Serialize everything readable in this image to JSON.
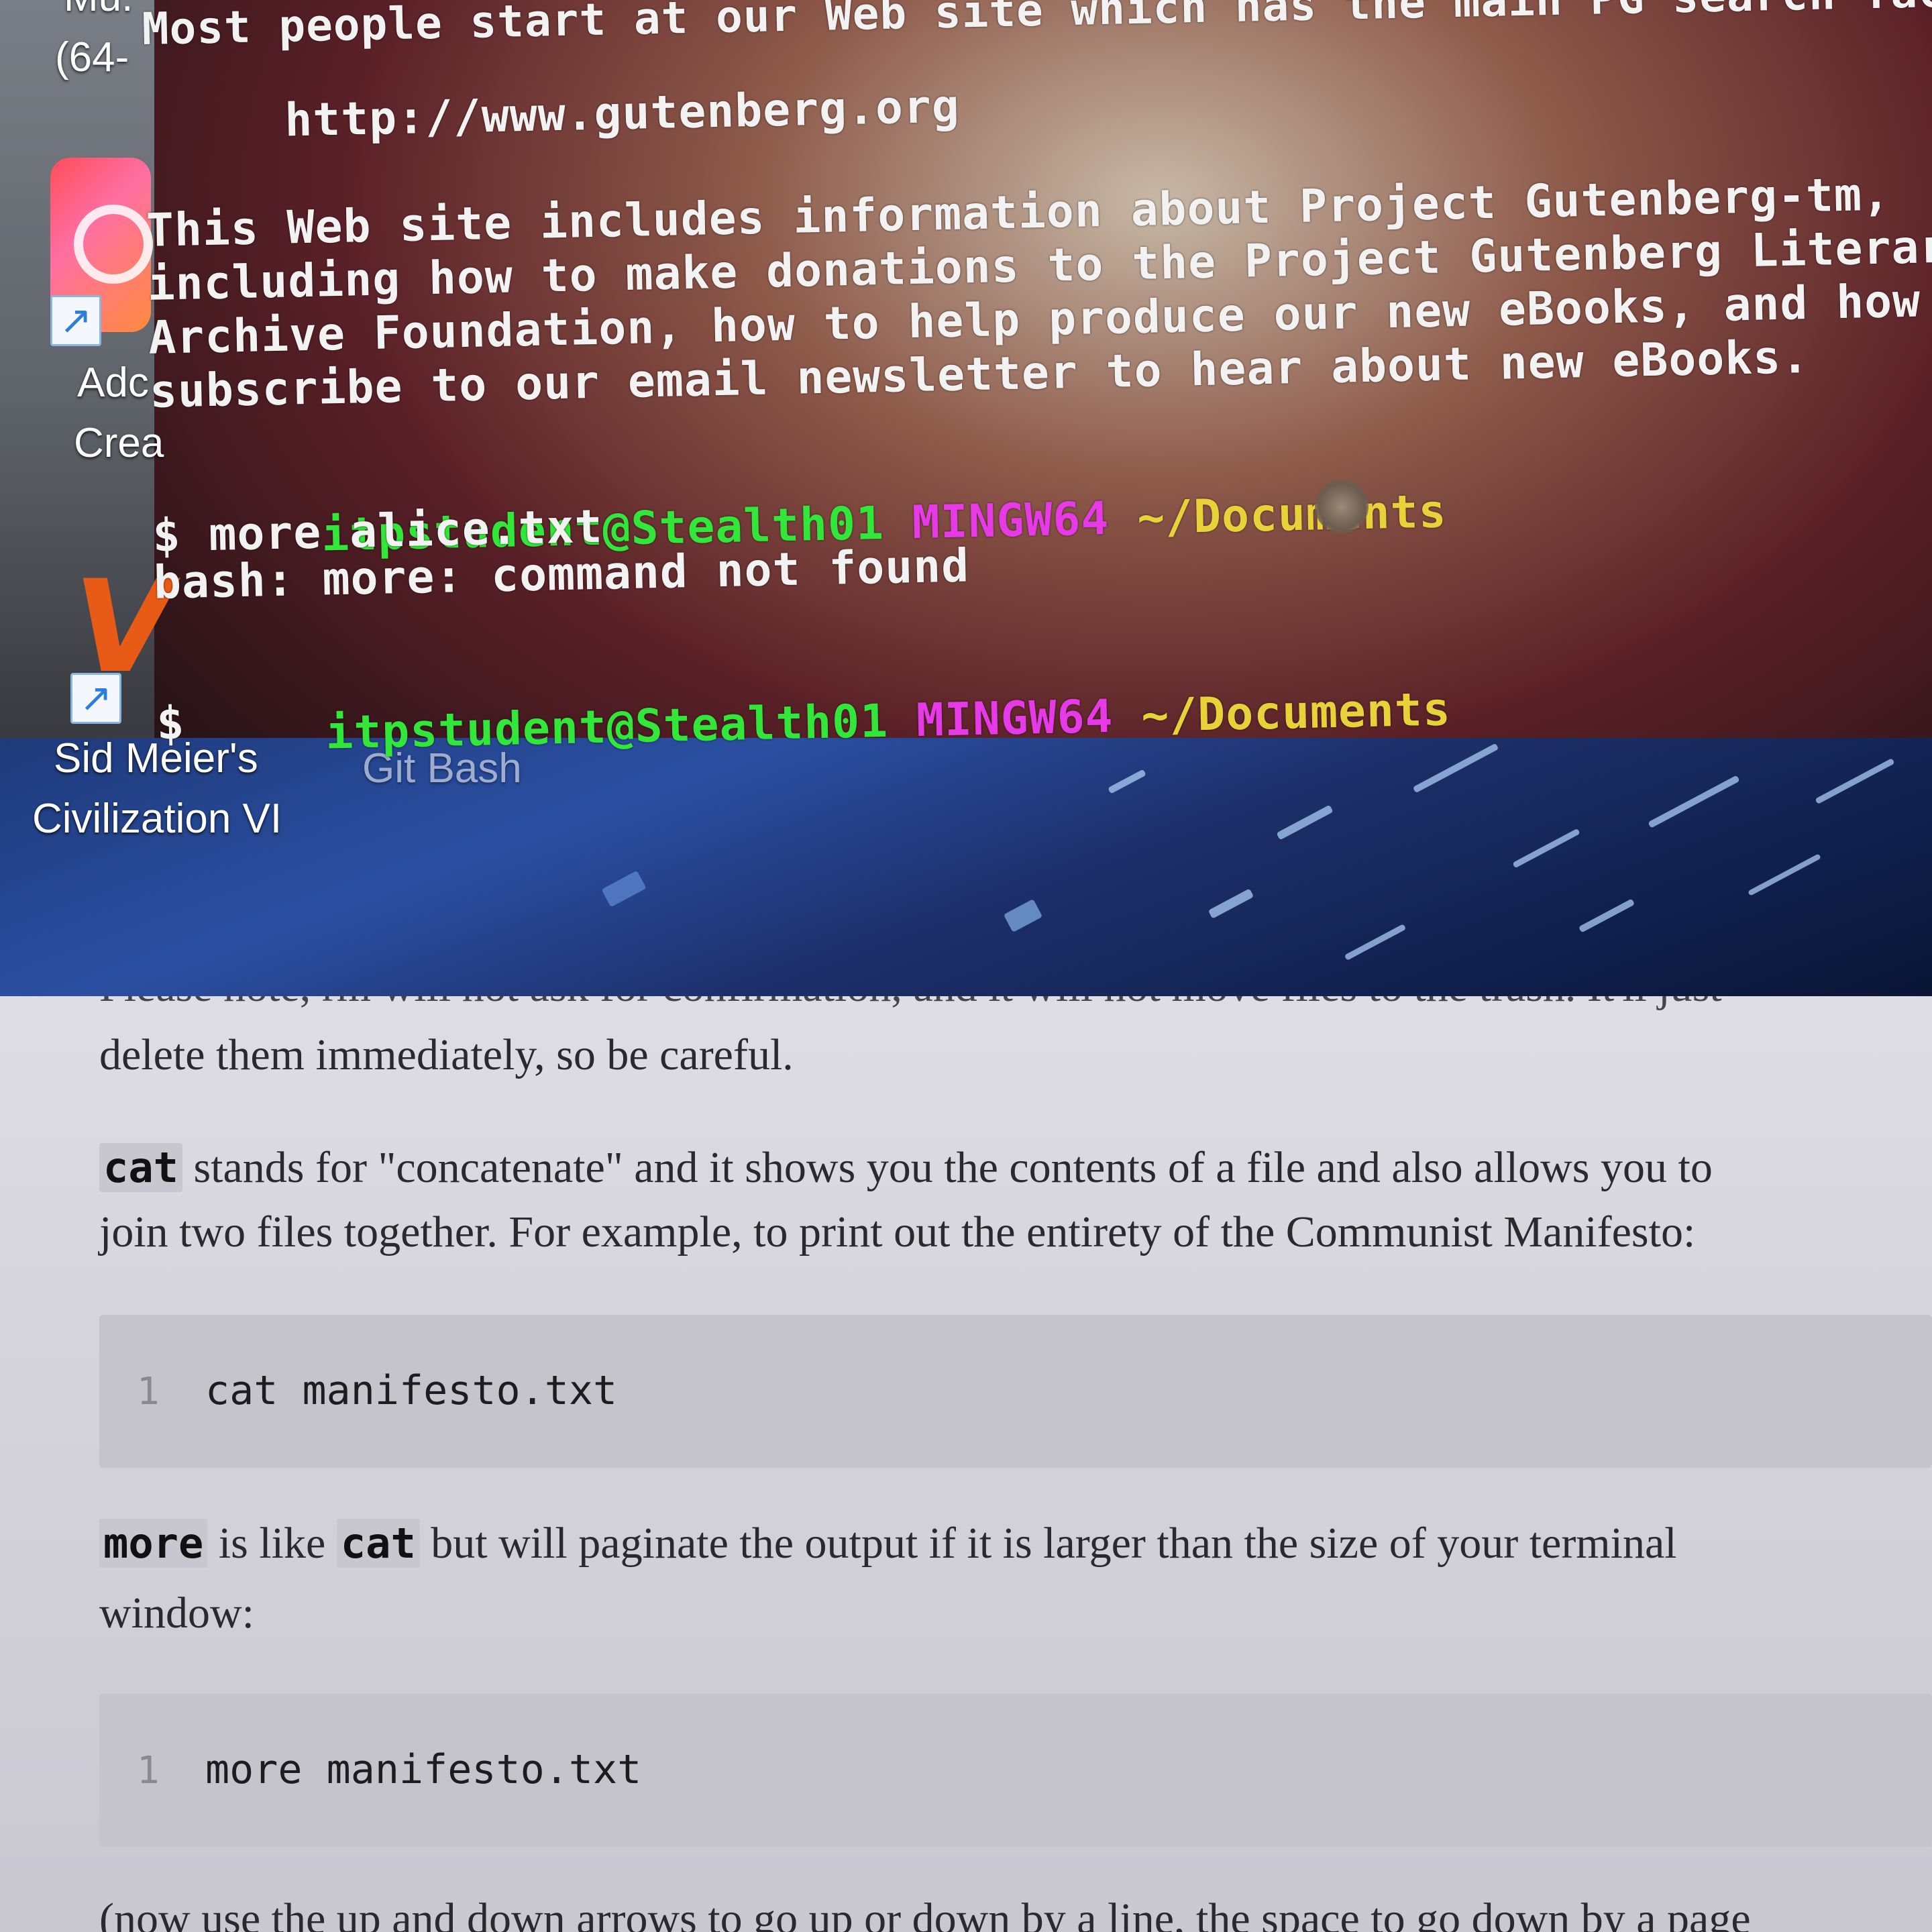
{
  "desktop": {
    "partial_label_top": "Mu.",
    "partial_label_64": "(64-",
    "shortcut_arrow_glyph": "↗",
    "icons": [
      {
        "name": "adobe-creative-cloud",
        "label_line1": "Adc",
        "label_line2": "Crea"
      },
      {
        "name": "civilization-vi",
        "label_line1": "Sid Meier's",
        "label_line2": "Civilization VI"
      },
      {
        "name": "git-bash",
        "label_line1": "Git Bash"
      }
    ]
  },
  "terminal": {
    "lines": [
      "Most people start at our Web site which has the main PG search fac",
      "     http://www.gutenberg.org",
      "This Web site includes information about Project Gutenberg-tm,",
      "including how to make donations to the Project Gutenberg Literary",
      "Archive Foundation, how to help produce our new eBooks, and how to",
      "subscribe to our email newsletter to hear about new eBooks."
    ],
    "prompt_user": "itpstudent@Stealth01",
    "prompt_host": "MINGW64",
    "prompt_path": "~/Documents",
    "command": "$ more alice.txt",
    "error": "bash: more: command not found",
    "cursor_prompt": "$"
  },
  "document": {
    "partial_top_line": "Please note, rm will not ask for confirmation, and it will not move files to the trash. It'll just",
    "line_delete": "delete them immediately, so be careful.",
    "cat_term": "cat",
    "cat_line1_rest": " stands for \"concatenate\" and it shows you the contents of a file and also allows you to",
    "cat_line2": "join two files together. For example, to print out the entirety of the Communist Manifesto:",
    "code1": {
      "line_number": "1",
      "code": "cat manifesto.txt"
    },
    "more_term": "more",
    "more_line1_mid": " is like ",
    "more_line1_cat": "cat",
    "more_line1_rest": " but will paginate the output if it is larger than the size of your terminal",
    "more_line2": "window:",
    "code2": {
      "line_number": "1",
      "code": "more manifesto.txt"
    },
    "partial_bottom_line": "(now use the up and down arrows to go up or down by a line, the space to go down by a page"
  },
  "colors": {
    "prompt_user": "#33e63a",
    "prompt_host": "#e63ae6",
    "prompt_path": "#e8d23a",
    "doc_background": "#d6d4dc",
    "code_block": "#c5c3cc"
  }
}
